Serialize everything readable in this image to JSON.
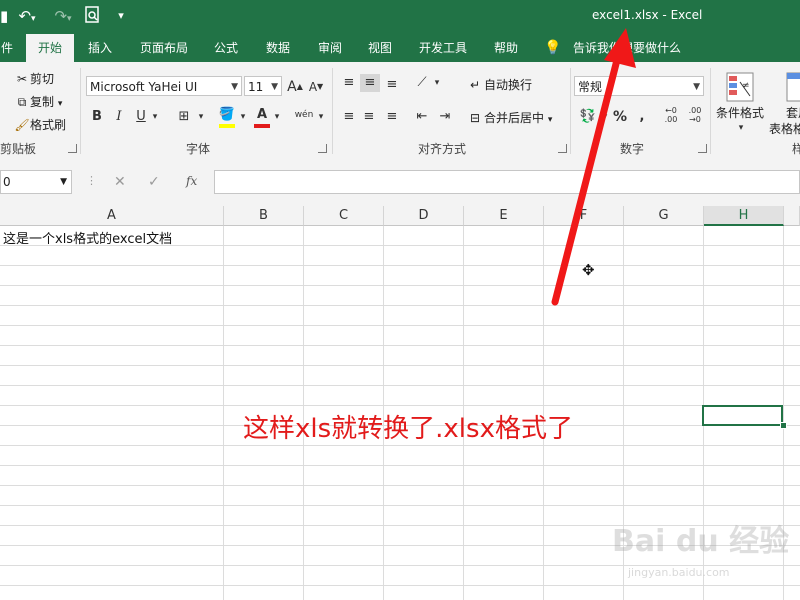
{
  "window": {
    "title": "excel1.xlsx  -  Excel"
  },
  "qat": {
    "undo_icon": "undo-icon",
    "redo_icon": "redo-icon",
    "preview_icon": "print-preview-icon",
    "customize_icon": "customize-qat-icon"
  },
  "tabs": [
    {
      "label": "件"
    },
    {
      "label": "开始"
    },
    {
      "label": "插入"
    },
    {
      "label": "页面布局"
    },
    {
      "label": "公式"
    },
    {
      "label": "数据"
    },
    {
      "label": "审阅"
    },
    {
      "label": "视图"
    },
    {
      "label": "开发工具"
    },
    {
      "label": "帮助"
    },
    {
      "label": "告诉我你想要做什么"
    }
  ],
  "ribbon": {
    "clipboard": {
      "cut": "剪切",
      "copy": "复制",
      "format_painter": "格式刷",
      "label": "剪贴板"
    },
    "font": {
      "name": "Microsoft YaHei UI",
      "size": "11",
      "grow": "A",
      "shrink": "A",
      "bold": "B",
      "italic": "I",
      "underline": "U",
      "phonetic": "wén",
      "label": "字体"
    },
    "alignment": {
      "wrap": "自动换行",
      "merge": "合并后居中",
      "label": "对齐方式"
    },
    "number": {
      "format": "常规",
      "percent": "%",
      "label": "数字"
    },
    "styles": {
      "conditional": "条件格式",
      "table": "套用",
      "table2": "表格格",
      "label": "样"
    }
  },
  "formula_bar": {
    "name_box": "0",
    "cancel": "✕",
    "enter": "✓",
    "fx": "fx"
  },
  "columns": [
    "A",
    "B",
    "C",
    "D",
    "E",
    "F",
    "G",
    "H"
  ],
  "cells": {
    "A1": "这是一个xls格式的excel文档"
  },
  "annotation": "这样xls就转换了.xlsx格式了",
  "watermark": {
    "main": "Bai du 经验",
    "sub": "jingyan.baidu.com"
  },
  "colors": {
    "excel_green": "#217346",
    "annotation_red": "#e21b1b"
  }
}
